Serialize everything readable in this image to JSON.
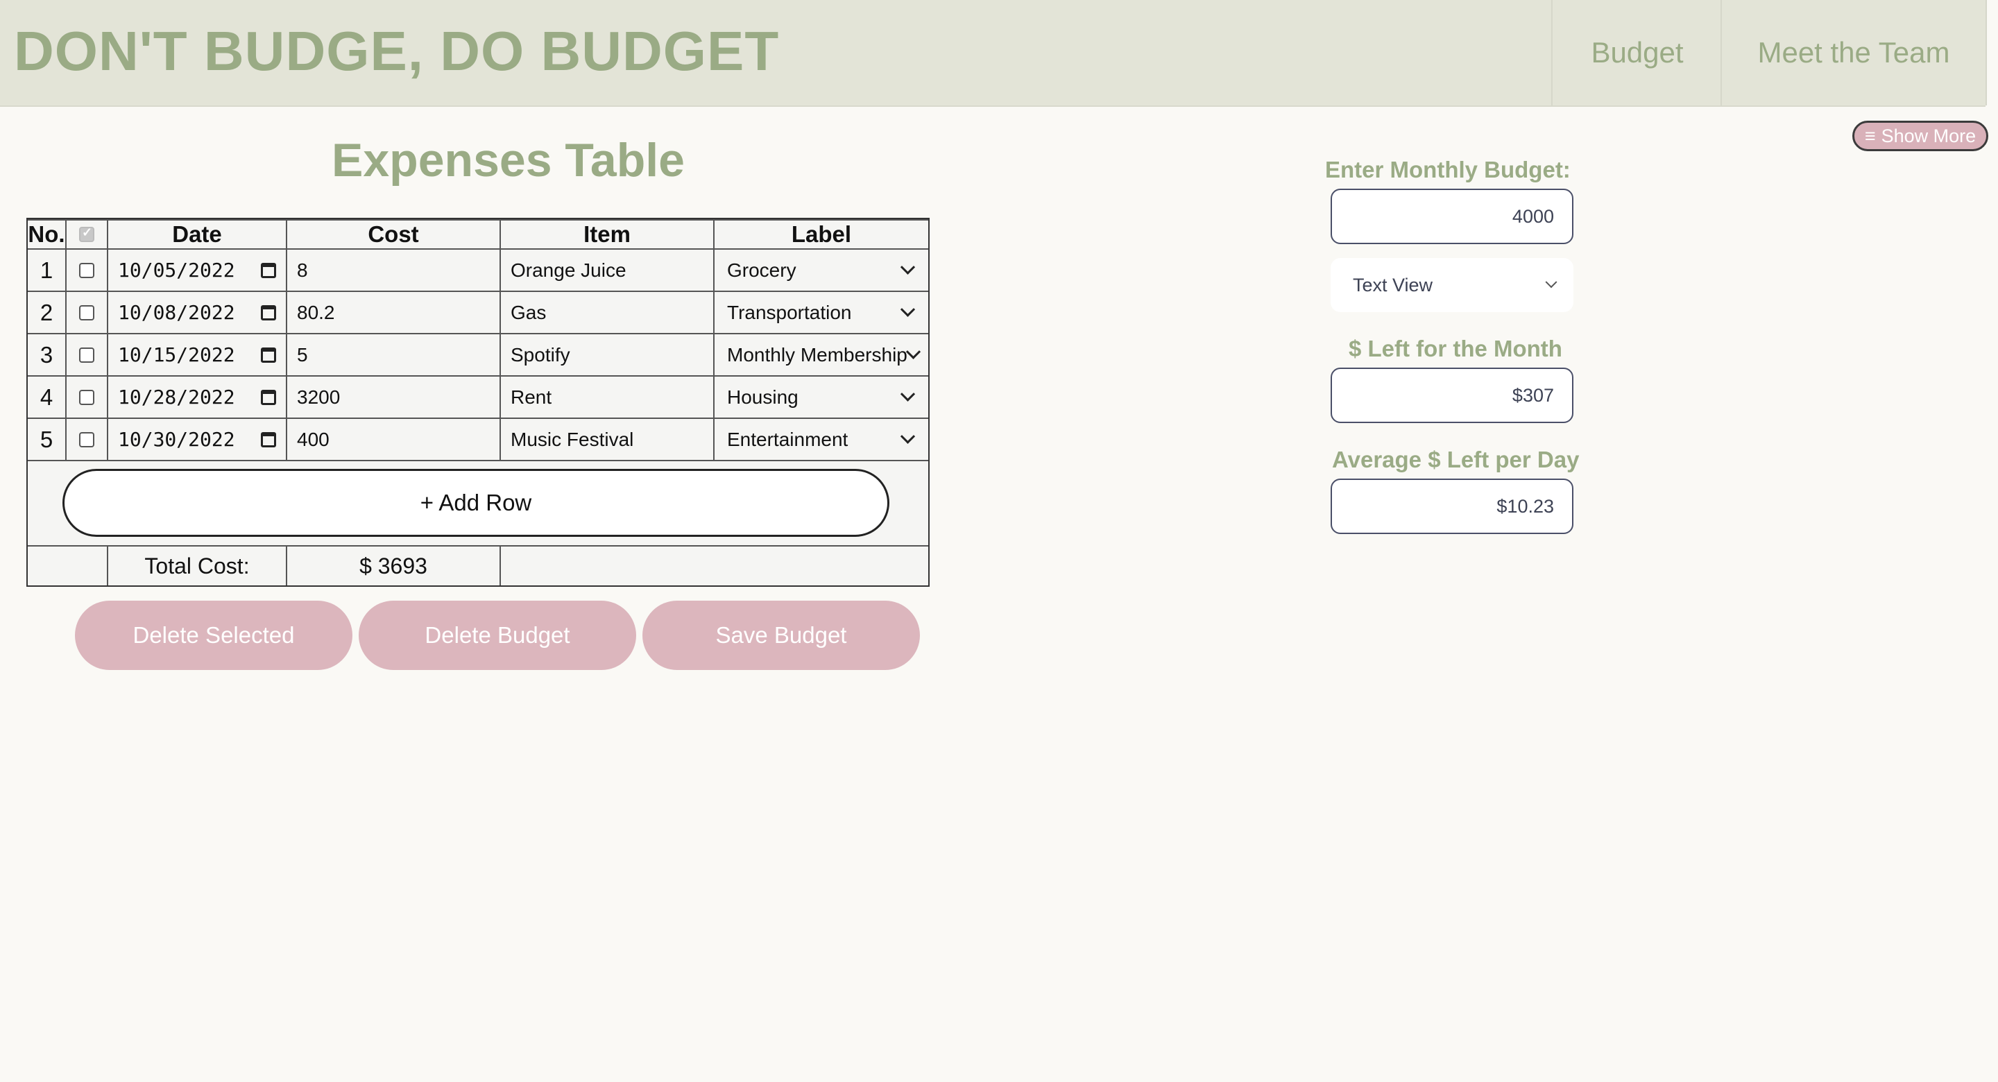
{
  "header": {
    "brand": "DON'T BUDGE, DO BUDGET",
    "nav": [
      "Budget",
      "Meet the Team"
    ]
  },
  "show_more": {
    "icon": "hamburger-icon",
    "label": "Show More"
  },
  "expenses": {
    "title": "Expenses Table",
    "columns": [
      "No.",
      "",
      "Date",
      "Cost",
      "Item",
      "Label"
    ],
    "rows": [
      {
        "no": "1",
        "date": "10/05/2022",
        "cost": "8",
        "item": "Orange Juice",
        "label": "Grocery"
      },
      {
        "no": "2",
        "date": "10/08/2022",
        "cost": "80.2",
        "item": "Gas",
        "label": "Transportation"
      },
      {
        "no": "3",
        "date": "10/15/2022",
        "cost": "5",
        "item": "Spotify",
        "label": "Monthly Membership"
      },
      {
        "no": "4",
        "date": "10/28/2022",
        "cost": "3200",
        "item": "Rent",
        "label": "Housing"
      },
      {
        "no": "5",
        "date": "10/30/2022",
        "cost": "400",
        "item": "Music Festival",
        "label": "Entertainment"
      }
    ],
    "add_row_label": "+ Add Row",
    "total_label": "Total Cost:",
    "total_value": "$ 3693"
  },
  "actions": {
    "delete_selected": "Delete Selected",
    "delete_budget": "Delete Budget",
    "save_budget": "Save Budget"
  },
  "budget_panel": {
    "monthly_label": "Enter Monthly Budget:",
    "monthly_value": "4000",
    "view_selected": "Text View",
    "left_label": "$ Left for the Month",
    "left_value": "$307",
    "avg_label": "Average $ Left per Day",
    "avg_value": "$10.23"
  },
  "colors": {
    "accent_green": "#9aab85",
    "header_bg": "#e3e4d7",
    "button_pink": "#dcb6bd",
    "page_bg": "#faf9f5"
  }
}
